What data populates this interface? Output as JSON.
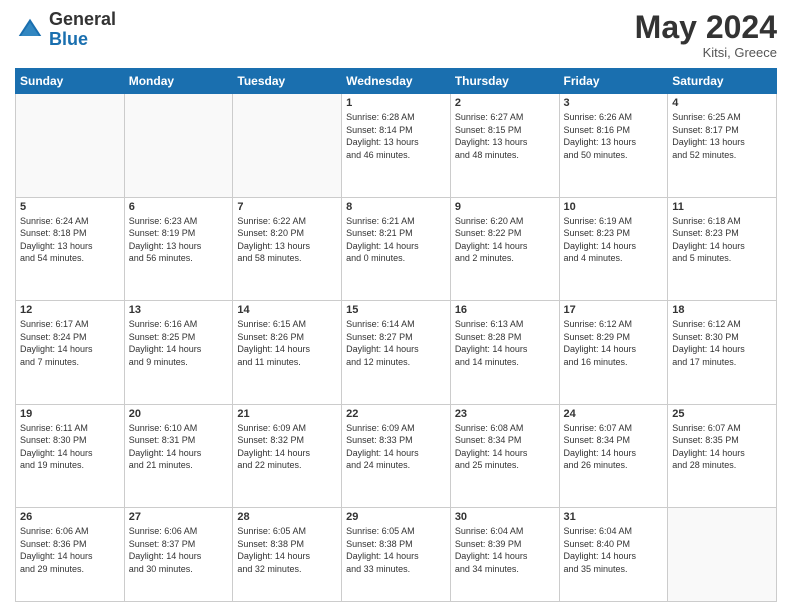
{
  "header": {
    "logo_general": "General",
    "logo_blue": "Blue",
    "month_title": "May 2024",
    "location": "Kitsi, Greece"
  },
  "days_of_week": [
    "Sunday",
    "Monday",
    "Tuesday",
    "Wednesday",
    "Thursday",
    "Friday",
    "Saturday"
  ],
  "weeks": [
    [
      {
        "day": "",
        "info": ""
      },
      {
        "day": "",
        "info": ""
      },
      {
        "day": "",
        "info": ""
      },
      {
        "day": "1",
        "info": "Sunrise: 6:28 AM\nSunset: 8:14 PM\nDaylight: 13 hours\nand 46 minutes."
      },
      {
        "day": "2",
        "info": "Sunrise: 6:27 AM\nSunset: 8:15 PM\nDaylight: 13 hours\nand 48 minutes."
      },
      {
        "day": "3",
        "info": "Sunrise: 6:26 AM\nSunset: 8:16 PM\nDaylight: 13 hours\nand 50 minutes."
      },
      {
        "day": "4",
        "info": "Sunrise: 6:25 AM\nSunset: 8:17 PM\nDaylight: 13 hours\nand 52 minutes."
      }
    ],
    [
      {
        "day": "5",
        "info": "Sunrise: 6:24 AM\nSunset: 8:18 PM\nDaylight: 13 hours\nand 54 minutes."
      },
      {
        "day": "6",
        "info": "Sunrise: 6:23 AM\nSunset: 8:19 PM\nDaylight: 13 hours\nand 56 minutes."
      },
      {
        "day": "7",
        "info": "Sunrise: 6:22 AM\nSunset: 8:20 PM\nDaylight: 13 hours\nand 58 minutes."
      },
      {
        "day": "8",
        "info": "Sunrise: 6:21 AM\nSunset: 8:21 PM\nDaylight: 14 hours\nand 0 minutes."
      },
      {
        "day": "9",
        "info": "Sunrise: 6:20 AM\nSunset: 8:22 PM\nDaylight: 14 hours\nand 2 minutes."
      },
      {
        "day": "10",
        "info": "Sunrise: 6:19 AM\nSunset: 8:23 PM\nDaylight: 14 hours\nand 4 minutes."
      },
      {
        "day": "11",
        "info": "Sunrise: 6:18 AM\nSunset: 8:23 PM\nDaylight: 14 hours\nand 5 minutes."
      }
    ],
    [
      {
        "day": "12",
        "info": "Sunrise: 6:17 AM\nSunset: 8:24 PM\nDaylight: 14 hours\nand 7 minutes."
      },
      {
        "day": "13",
        "info": "Sunrise: 6:16 AM\nSunset: 8:25 PM\nDaylight: 14 hours\nand 9 minutes."
      },
      {
        "day": "14",
        "info": "Sunrise: 6:15 AM\nSunset: 8:26 PM\nDaylight: 14 hours\nand 11 minutes."
      },
      {
        "day": "15",
        "info": "Sunrise: 6:14 AM\nSunset: 8:27 PM\nDaylight: 14 hours\nand 12 minutes."
      },
      {
        "day": "16",
        "info": "Sunrise: 6:13 AM\nSunset: 8:28 PM\nDaylight: 14 hours\nand 14 minutes."
      },
      {
        "day": "17",
        "info": "Sunrise: 6:12 AM\nSunset: 8:29 PM\nDaylight: 14 hours\nand 16 minutes."
      },
      {
        "day": "18",
        "info": "Sunrise: 6:12 AM\nSunset: 8:30 PM\nDaylight: 14 hours\nand 17 minutes."
      }
    ],
    [
      {
        "day": "19",
        "info": "Sunrise: 6:11 AM\nSunset: 8:30 PM\nDaylight: 14 hours\nand 19 minutes."
      },
      {
        "day": "20",
        "info": "Sunrise: 6:10 AM\nSunset: 8:31 PM\nDaylight: 14 hours\nand 21 minutes."
      },
      {
        "day": "21",
        "info": "Sunrise: 6:09 AM\nSunset: 8:32 PM\nDaylight: 14 hours\nand 22 minutes."
      },
      {
        "day": "22",
        "info": "Sunrise: 6:09 AM\nSunset: 8:33 PM\nDaylight: 14 hours\nand 24 minutes."
      },
      {
        "day": "23",
        "info": "Sunrise: 6:08 AM\nSunset: 8:34 PM\nDaylight: 14 hours\nand 25 minutes."
      },
      {
        "day": "24",
        "info": "Sunrise: 6:07 AM\nSunset: 8:34 PM\nDaylight: 14 hours\nand 26 minutes."
      },
      {
        "day": "25",
        "info": "Sunrise: 6:07 AM\nSunset: 8:35 PM\nDaylight: 14 hours\nand 28 minutes."
      }
    ],
    [
      {
        "day": "26",
        "info": "Sunrise: 6:06 AM\nSunset: 8:36 PM\nDaylight: 14 hours\nand 29 minutes."
      },
      {
        "day": "27",
        "info": "Sunrise: 6:06 AM\nSunset: 8:37 PM\nDaylight: 14 hours\nand 30 minutes."
      },
      {
        "day": "28",
        "info": "Sunrise: 6:05 AM\nSunset: 8:38 PM\nDaylight: 14 hours\nand 32 minutes."
      },
      {
        "day": "29",
        "info": "Sunrise: 6:05 AM\nSunset: 8:38 PM\nDaylight: 14 hours\nand 33 minutes."
      },
      {
        "day": "30",
        "info": "Sunrise: 6:04 AM\nSunset: 8:39 PM\nDaylight: 14 hours\nand 34 minutes."
      },
      {
        "day": "31",
        "info": "Sunrise: 6:04 AM\nSunset: 8:40 PM\nDaylight: 14 hours\nand 35 minutes."
      },
      {
        "day": "",
        "info": ""
      }
    ]
  ]
}
